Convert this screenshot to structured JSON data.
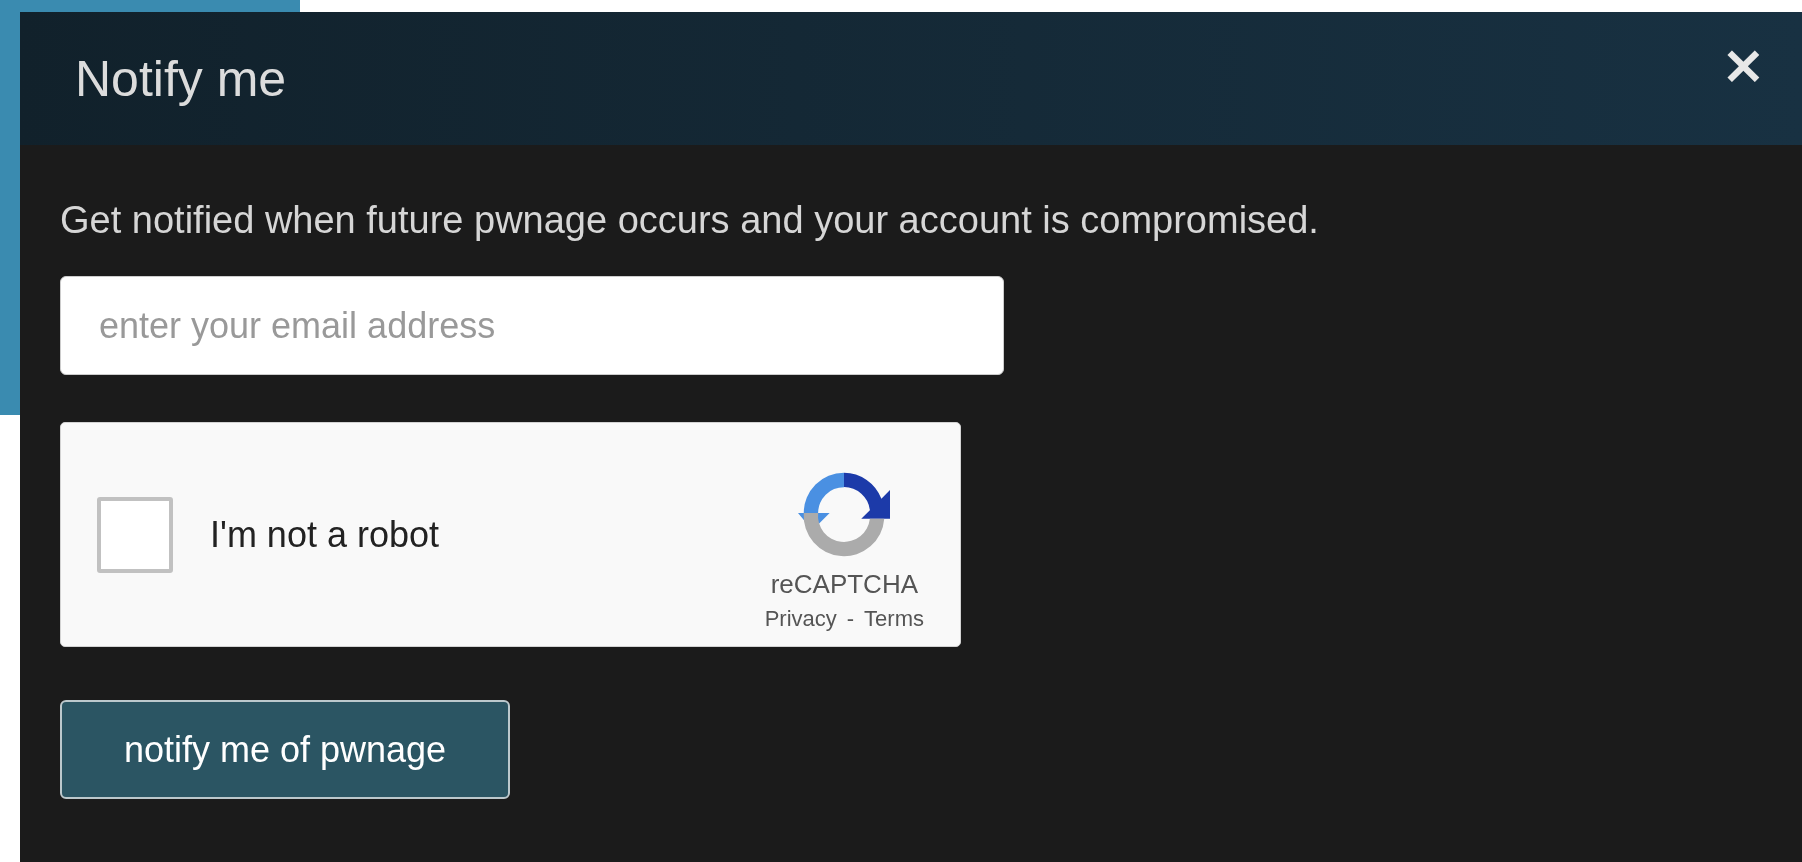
{
  "modal": {
    "title": "Notify me",
    "close": "×"
  },
  "message": "Get notified when future pwnage occurs and your account is compromised.",
  "email": {
    "placeholder": "enter your email address"
  },
  "captcha": {
    "label": "I'm not a robot",
    "checked": false,
    "brand": "reCAPTCHA",
    "privacy": "Privacy",
    "separator": "-",
    "terms": "Terms"
  },
  "submit": "notify me of pwnage"
}
